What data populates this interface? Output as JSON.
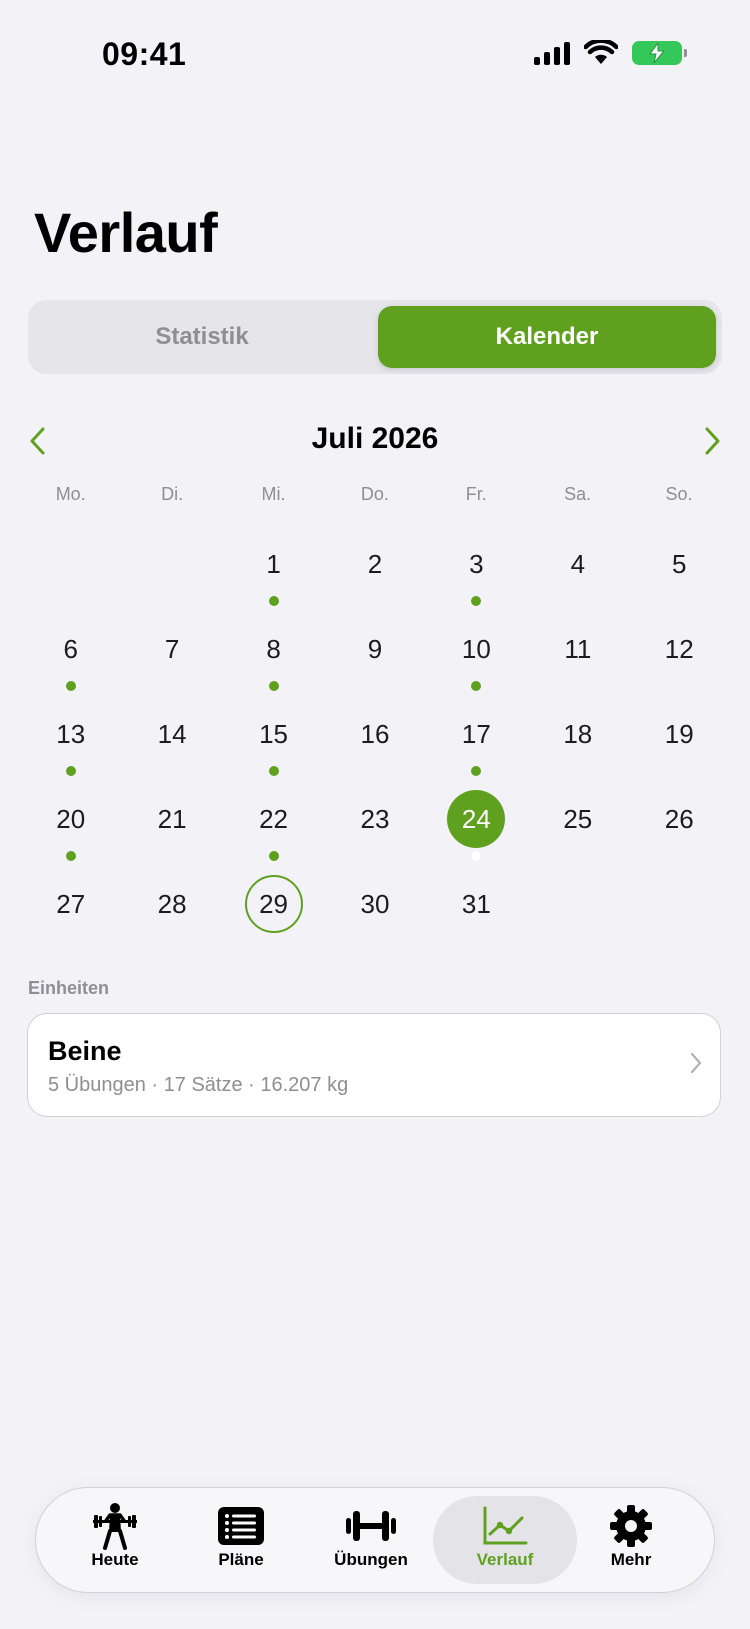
{
  "status": {
    "time": "09:41"
  },
  "page": {
    "title": "Verlauf"
  },
  "segments": {
    "statistik": "Statistik",
    "kalender": "Kalender"
  },
  "calendar": {
    "month_label": "Juli 2026",
    "weekdays": [
      "Mo.",
      "Di.",
      "Mi.",
      "Do.",
      "Fr.",
      "Sa.",
      "So."
    ],
    "selected_day": "24",
    "today": "29",
    "days": [
      {
        "d": "",
        "dot": false
      },
      {
        "d": "",
        "dot": false
      },
      {
        "d": "1",
        "dot": true
      },
      {
        "d": "2",
        "dot": false
      },
      {
        "d": "3",
        "dot": true
      },
      {
        "d": "4",
        "dot": false
      },
      {
        "d": "5",
        "dot": false
      },
      {
        "d": "6",
        "dot": true
      },
      {
        "d": "7",
        "dot": false
      },
      {
        "d": "8",
        "dot": true
      },
      {
        "d": "9",
        "dot": false
      },
      {
        "d": "10",
        "dot": true
      },
      {
        "d": "11",
        "dot": false
      },
      {
        "d": "12",
        "dot": false
      },
      {
        "d": "13",
        "dot": true
      },
      {
        "d": "14",
        "dot": false
      },
      {
        "d": "15",
        "dot": true
      },
      {
        "d": "16",
        "dot": false
      },
      {
        "d": "17",
        "dot": true
      },
      {
        "d": "18",
        "dot": false
      },
      {
        "d": "19",
        "dot": false
      },
      {
        "d": "20",
        "dot": true
      },
      {
        "d": "21",
        "dot": false
      },
      {
        "d": "22",
        "dot": true
      },
      {
        "d": "23",
        "dot": false
      },
      {
        "d": "24",
        "dot": true
      },
      {
        "d": "25",
        "dot": false
      },
      {
        "d": "26",
        "dot": false
      },
      {
        "d": "27",
        "dot": false
      },
      {
        "d": "28",
        "dot": false
      },
      {
        "d": "29",
        "dot": false
      },
      {
        "d": "30",
        "dot": false
      },
      {
        "d": "31",
        "dot": false
      }
    ]
  },
  "sessions": {
    "section_label": "Einheiten",
    "items": [
      {
        "title": "Beine",
        "subtitle": "5 Übungen · 17 Sätze · 16.207 kg"
      }
    ]
  },
  "tabbar": {
    "items": [
      {
        "label": "Heute",
        "icon": "weightlifter-icon"
      },
      {
        "label": "Pläne",
        "icon": "list-icon"
      },
      {
        "label": "Übungen",
        "icon": "dumbbell-icon"
      },
      {
        "label": "Verlauf",
        "icon": "chart-icon"
      },
      {
        "label": "Mehr",
        "icon": "gear-icon"
      }
    ],
    "active": "Verlauf"
  },
  "colors": {
    "accent": "#5fa11f",
    "background": "#f2f2f7",
    "battery": "#34c759"
  }
}
